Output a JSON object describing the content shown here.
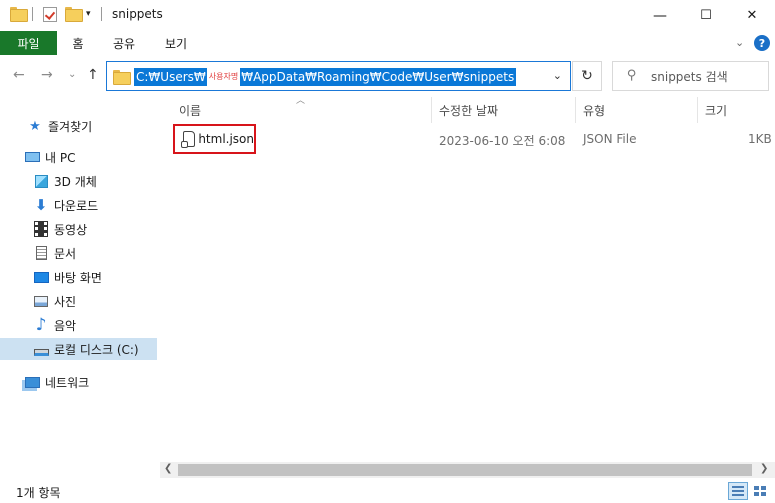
{
  "window": {
    "title": "snippets",
    "minimize_glyph": "—",
    "maximize_glyph": "☐",
    "close_glyph": "✕"
  },
  "ribbon": {
    "tabs": [
      "파일",
      "홈",
      "공유",
      "보기"
    ],
    "file_tab_color": "#19782a",
    "help_glyph": "?"
  },
  "address": {
    "path_start": "C:₩Users₩",
    "user_redacted": "사용자명",
    "path_end": "₩AppData₩Roaming₩Code₩User₩snippets",
    "selection_color": "#0a78d7"
  },
  "search": {
    "placeholder": "snippets 검색"
  },
  "sidebar": {
    "items": [
      {
        "label": "즐겨찾기",
        "icon": "star-icon"
      },
      {
        "label": "내 PC",
        "icon": "computer-icon"
      },
      {
        "label": "3D 개체",
        "icon": "cube-3d-icon"
      },
      {
        "label": "다운로드",
        "icon": "download-arrow-icon"
      },
      {
        "label": "동영상",
        "icon": "film-icon"
      },
      {
        "label": "문서",
        "icon": "document-icon"
      },
      {
        "label": "바탕 화면",
        "icon": "desktop-icon"
      },
      {
        "label": "사진",
        "icon": "picture-icon"
      },
      {
        "label": "음악",
        "icon": "music-note-icon"
      },
      {
        "label": "로컬 디스크 (C:)",
        "icon": "drive-icon"
      },
      {
        "label": "네트워크",
        "icon": "network-icon"
      }
    ]
  },
  "columns": {
    "name": "이름",
    "modified": "수정한 날짜",
    "type": "유형",
    "size": "크기"
  },
  "files": [
    {
      "name": "html.json",
      "modified": "2023-06-10 오전 6:08",
      "type": "JSON File",
      "size": "1KB"
    }
  ],
  "status": {
    "item_count": "1개 항목"
  },
  "highlight_color": "#d7141a"
}
